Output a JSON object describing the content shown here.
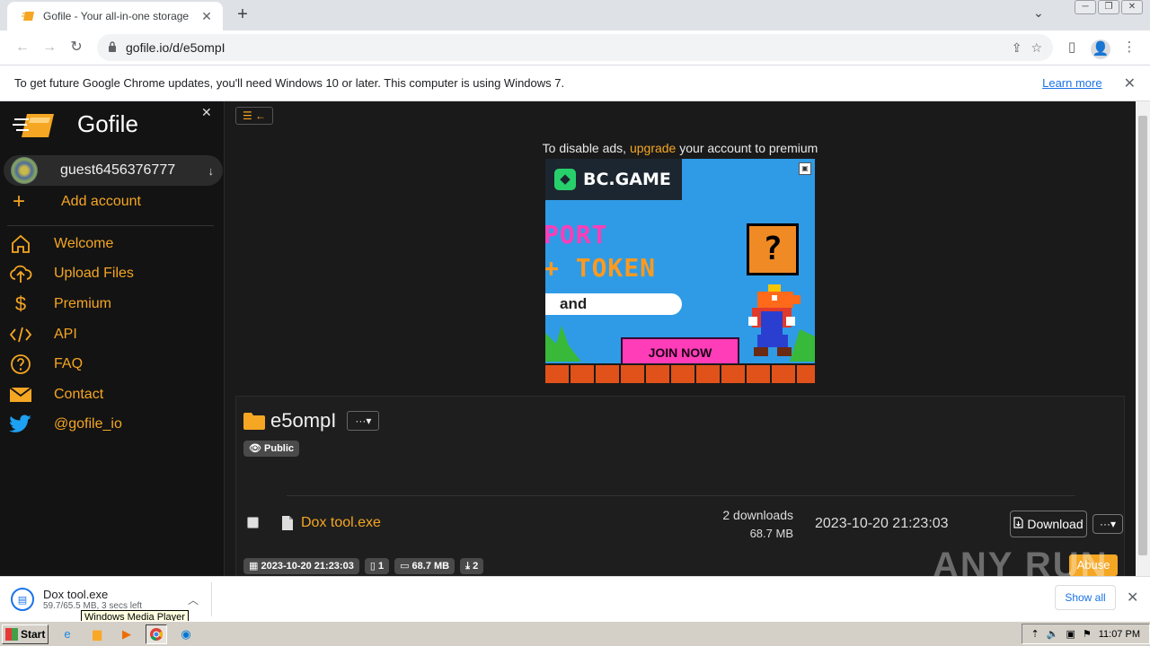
{
  "browser": {
    "tab_title": "Gofile - Your all-in-one storage solution",
    "new_tab": "+",
    "url": "gofile.io/d/e5ompI",
    "infobar_message": "To get future Google Chrome updates, you'll need Windows 10 or later. This computer is using Windows 7.",
    "infobar_link": "Learn more"
  },
  "sidebar": {
    "brand": "Gofile",
    "account_name": "guest6456376777",
    "add_account": "Add account",
    "items": [
      {
        "label": "Welcome",
        "icon": "home-icon"
      },
      {
        "label": "Upload Files",
        "icon": "upload-icon"
      },
      {
        "label": "Premium",
        "icon": "dollar-icon"
      },
      {
        "label": "API",
        "icon": "code-icon"
      },
      {
        "label": "FAQ",
        "icon": "question-icon"
      },
      {
        "label": "Contact",
        "icon": "envelope-icon"
      },
      {
        "label": "@gofile_io",
        "icon": "twitter-icon"
      }
    ]
  },
  "ad": {
    "note_prefix": "To disable ads,",
    "note_link": "upgrade",
    "note_suffix": "your account to premium",
    "brand": "BC.GAME",
    "line1": "PORT",
    "line2": "+ TOKEN",
    "pill": "and",
    "question": "?",
    "cta": "JOIN NOW"
  },
  "folder": {
    "name": "e5ompI",
    "menu": "···▾",
    "visibility": "Public",
    "file": {
      "name": "Dox tool.exe",
      "downloads": "2 downloads",
      "size": "68.7 MB",
      "date": "2023-10-20 21:23:03",
      "download_label": "Download",
      "more": "···▾"
    },
    "meta": {
      "date": "2023-10-20 21:23:03",
      "files": "1",
      "size": "68.7 MB",
      "downloads": "2"
    },
    "abuse": "Abuse"
  },
  "watermark": "ANY RUN",
  "download_shelf": {
    "file_name": "Dox tool.exe",
    "status": "59.7/65.5 MB, 3 secs left",
    "tooltip": "Windows Media Player",
    "show_all": "Show all"
  },
  "taskbar": {
    "start": "Start",
    "time": "11:07 PM"
  },
  "colors": {
    "accent": "#f5a623",
    "page_bg": "#1a1a1a",
    "sidebar_bg": "#131313"
  }
}
